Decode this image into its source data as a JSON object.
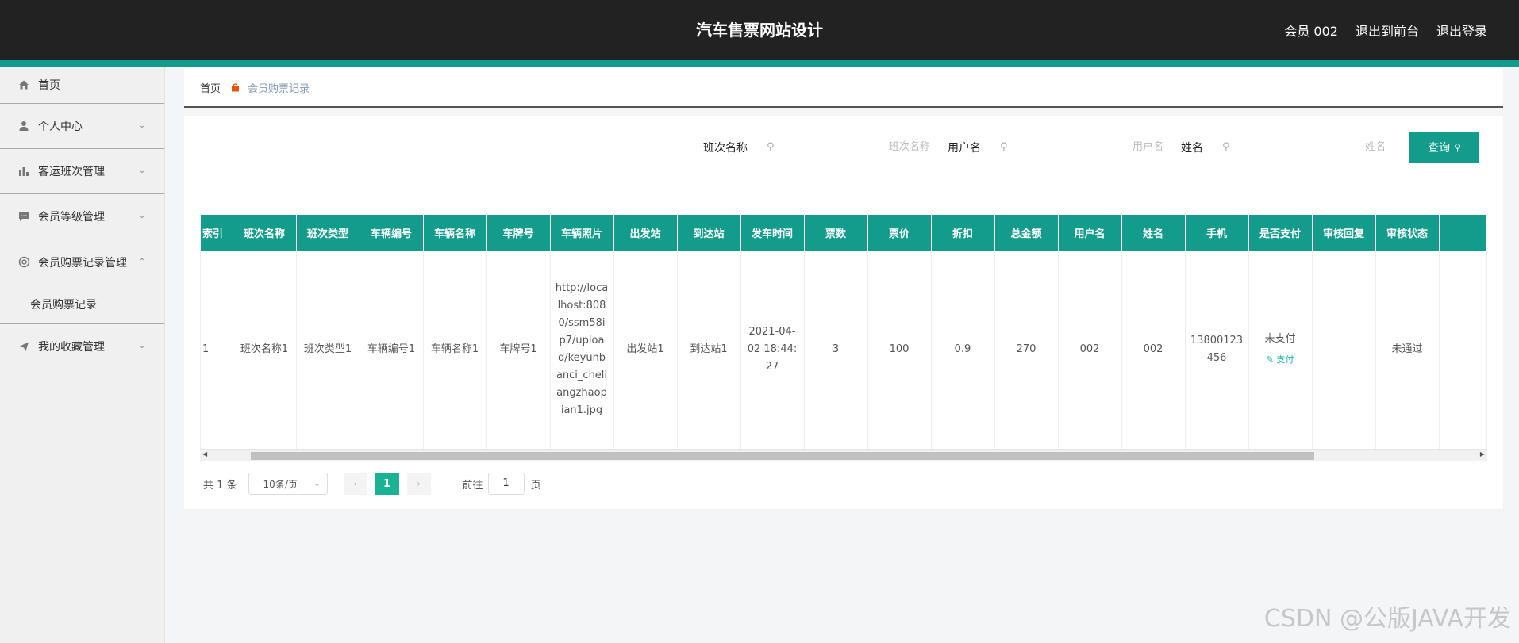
{
  "header": {
    "title": "汽车售票网站设计",
    "links": [
      "会员 002",
      "退出到前台",
      "退出登录"
    ]
  },
  "sidebar": {
    "items": [
      {
        "label": "首页",
        "icon": "home-icon"
      },
      {
        "label": "个人中心",
        "icon": "user-icon"
      },
      {
        "label": "客运班次管理",
        "icon": "bar-chart-icon"
      },
      {
        "label": "会员等级管理",
        "icon": "chat-icon"
      },
      {
        "label": "会员购票记录管理",
        "icon": "gear-icon",
        "expanded": true
      },
      {
        "label": "我的收藏管理",
        "icon": "send-icon"
      }
    ],
    "submenu_label": "会员购票记录"
  },
  "breadcrumb": {
    "home": "首页",
    "current": "会员购票记录"
  },
  "search": {
    "fields": [
      {
        "label": "班次名称",
        "placeholder": "班次名称"
      },
      {
        "label": "用户名",
        "placeholder": "用户名"
      },
      {
        "label": "姓名",
        "placeholder": "姓名"
      }
    ],
    "button": "查询"
  },
  "table": {
    "columns": [
      "索引",
      "班次名称",
      "班次类型",
      "车辆编号",
      "车辆名称",
      "车牌号",
      "车辆照片",
      "出发站",
      "到达站",
      "发车时间",
      "票数",
      "票价",
      "折扣",
      "总金额",
      "用户名",
      "姓名",
      "手机",
      "是否支付",
      "审核回复",
      "审核状态"
    ],
    "rows": [
      {
        "index": "1",
        "banci_name": "班次名称1",
        "banci_type": "班次类型1",
        "vehicle_no": "车辆编号1",
        "vehicle_name": "车辆名称1",
        "plate": "车牌号1",
        "photo": "http://localhost:8080/ssm58ip7/upload/keyunbanci_cheliangzhaopian1.jpg",
        "from": "出发站1",
        "to": "到达站1",
        "depart_time": "2021-04-02 18:44:27",
        "tickets": "3",
        "price": "100",
        "discount": "0.9",
        "total": "270",
        "username": "002",
        "name": "002",
        "phone": "13800123456",
        "paid": "未支付",
        "pay_action": "支付",
        "reply": "",
        "status": "未通过"
      }
    ]
  },
  "pagination": {
    "total": "共 1 条",
    "page_size": "10条/页",
    "current": "1",
    "goto_label": "前往",
    "goto_value": "1",
    "page_suffix": "页"
  },
  "watermark": "CSDN @公版JAVA开发",
  "colors": {
    "accent": "#139b8c",
    "header_bg": "#222222",
    "page_active": "#19b394"
  }
}
